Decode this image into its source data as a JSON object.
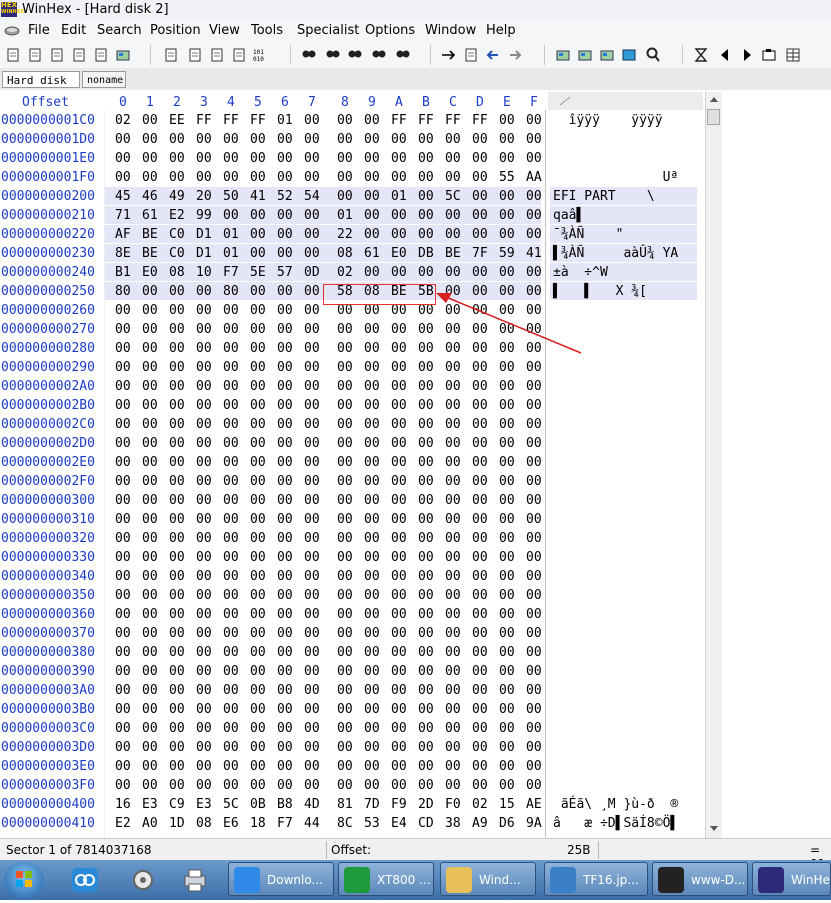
{
  "window": {
    "title": "WinHex - [Hard disk 2]"
  },
  "app_icon_lines": [
    "HEX",
    "WINHEX"
  ],
  "menu": [
    "File",
    "Edit",
    "Search",
    "Position",
    "View",
    "Tools",
    "Specialist",
    "Options",
    "Window",
    "Help"
  ],
  "toolbar_icons": [
    "new-file-icon",
    "open-folder-icon",
    "save-icon",
    "print-icon",
    "properties-icon",
    "open-disk-icon",
    "undo-icon",
    "copy-icon",
    "paste-icon",
    "paste-special-icon",
    "hex-convert-icon",
    "find-text-icon",
    "find-hex-icon",
    "replace-text-icon",
    "replace-hex-icon",
    "find-next-icon",
    "goto-offset-icon",
    "goto-sector-icon",
    "back-icon",
    "forward-icon",
    "disk-editor-icon",
    "ram-editor-icon",
    "clone-disk-icon",
    "calculator-icon",
    "search-icon",
    "hourglass-icon",
    "prev-sector-icon",
    "next-sector-icon",
    "snapshot-icon",
    "table-icon"
  ],
  "tabs": [
    {
      "label": "Hard disk 2",
      "active": true
    },
    {
      "label": "noname",
      "active": false
    }
  ],
  "hex_header": {
    "offset": "Offset",
    "columns": [
      "0",
      "1",
      "2",
      "3",
      "4",
      "5",
      "6",
      "7",
      "8",
      "9",
      "A",
      "B",
      "C",
      "D",
      "E",
      "F"
    ]
  },
  "rows": [
    {
      "offset": "0000000001C0",
      "bytes": [
        "02",
        "00",
        "EE",
        "FF",
        "FF",
        "FF",
        "01",
        "00",
        "00",
        "00",
        "FF",
        "FF",
        "FF",
        "FF",
        "00",
        "00"
      ],
      "text": "  îÿÿÿ    ÿÿÿÿ",
      "band": false
    },
    {
      "offset": "0000000001D0",
      "bytes": [
        "00",
        "00",
        "00",
        "00",
        "00",
        "00",
        "00",
        "00",
        "00",
        "00",
        "00",
        "00",
        "00",
        "00",
        "00",
        "00"
      ],
      "text": "",
      "band": false
    },
    {
      "offset": "0000000001E0",
      "bytes": [
        "00",
        "00",
        "00",
        "00",
        "00",
        "00",
        "00",
        "00",
        "00",
        "00",
        "00",
        "00",
        "00",
        "00",
        "00",
        "00"
      ],
      "text": "",
      "band": false
    },
    {
      "offset": "0000000001F0",
      "bytes": [
        "00",
        "00",
        "00",
        "00",
        "00",
        "00",
        "00",
        "00",
        "00",
        "00",
        "00",
        "00",
        "00",
        "00",
        "55",
        "AA"
      ],
      "text": "              Uª",
      "band": false
    },
    {
      "offset": "000000000200",
      "bytes": [
        "45",
        "46",
        "49",
        "20",
        "50",
        "41",
        "52",
        "54",
        "00",
        "00",
        "01",
        "00",
        "5C",
        "00",
        "00",
        "00"
      ],
      "text": "EFI PART    \\",
      "band": true
    },
    {
      "offset": "000000000210",
      "bytes": [
        "71",
        "61",
        "E2",
        "99",
        "00",
        "00",
        "00",
        "00",
        "01",
        "00",
        "00",
        "00",
        "00",
        "00",
        "00",
        "00"
      ],
      "text": "qaâ▌",
      "band": true
    },
    {
      "offset": "000000000220",
      "bytes": [
        "AF",
        "BE",
        "C0",
        "D1",
        "01",
        "00",
        "00",
        "00",
        "22",
        "00",
        "00",
        "00",
        "00",
        "00",
        "00",
        "00"
      ],
      "text": "¯¾ÀÑ    \"",
      "band": true
    },
    {
      "offset": "000000000230",
      "bytes": [
        "8E",
        "BE",
        "C0",
        "D1",
        "01",
        "00",
        "00",
        "00",
        "08",
        "61",
        "E0",
        "DB",
        "BE",
        "7F",
        "59",
        "41"
      ],
      "text": "▌¾ÀÑ     aàÛ¾ YA",
      "band": true
    },
    {
      "offset": "000000000240",
      "bytes": [
        "B1",
        "E0",
        "08",
        "10",
        "F7",
        "5E",
        "57",
        "0D",
        "02",
        "00",
        "00",
        "00",
        "00",
        "00",
        "00",
        "00"
      ],
      "text": "±à  ÷^W",
      "band": true
    },
    {
      "offset": "000000000250",
      "bytes": [
        "80",
        "00",
        "00",
        "00",
        "80",
        "00",
        "00",
        "00",
        "58",
        "08",
        "BE",
        "5B",
        "00",
        "00",
        "00",
        "00"
      ],
      "text": "▌   ▌   X ¾[",
      "band": true
    },
    {
      "offset": "000000000260",
      "bytes": [
        "00",
        "00",
        "00",
        "00",
        "00",
        "00",
        "00",
        "00",
        "00",
        "00",
        "00",
        "00",
        "00",
        "00",
        "00",
        "00"
      ],
      "text": "",
      "band": false
    },
    {
      "offset": "000000000270",
      "bytes": [
        "00",
        "00",
        "00",
        "00",
        "00",
        "00",
        "00",
        "00",
        "00",
        "00",
        "00",
        "00",
        "00",
        "00",
        "00",
        "00"
      ],
      "text": "",
      "band": false
    },
    {
      "offset": "000000000280",
      "bytes": [
        "00",
        "00",
        "00",
        "00",
        "00",
        "00",
        "00",
        "00",
        "00",
        "00",
        "00",
        "00",
        "00",
        "00",
        "00",
        "00"
      ],
      "text": "",
      "band": false
    },
    {
      "offset": "000000000290",
      "bytes": [
        "00",
        "00",
        "00",
        "00",
        "00",
        "00",
        "00",
        "00",
        "00",
        "00",
        "00",
        "00",
        "00",
        "00",
        "00",
        "00"
      ],
      "text": "",
      "band": false
    },
    {
      "offset": "0000000002A0",
      "bytes": [
        "00",
        "00",
        "00",
        "00",
        "00",
        "00",
        "00",
        "00",
        "00",
        "00",
        "00",
        "00",
        "00",
        "00",
        "00",
        "00"
      ],
      "text": "",
      "band": false
    },
    {
      "offset": "0000000002B0",
      "bytes": [
        "00",
        "00",
        "00",
        "00",
        "00",
        "00",
        "00",
        "00",
        "00",
        "00",
        "00",
        "00",
        "00",
        "00",
        "00",
        "00"
      ],
      "text": "",
      "band": false
    },
    {
      "offset": "0000000002C0",
      "bytes": [
        "00",
        "00",
        "00",
        "00",
        "00",
        "00",
        "00",
        "00",
        "00",
        "00",
        "00",
        "00",
        "00",
        "00",
        "00",
        "00"
      ],
      "text": "",
      "band": false
    },
    {
      "offset": "0000000002D0",
      "bytes": [
        "00",
        "00",
        "00",
        "00",
        "00",
        "00",
        "00",
        "00",
        "00",
        "00",
        "00",
        "00",
        "00",
        "00",
        "00",
        "00"
      ],
      "text": "",
      "band": false
    },
    {
      "offset": "0000000002E0",
      "bytes": [
        "00",
        "00",
        "00",
        "00",
        "00",
        "00",
        "00",
        "00",
        "00",
        "00",
        "00",
        "00",
        "00",
        "00",
        "00",
        "00"
      ],
      "text": "",
      "band": false
    },
    {
      "offset": "0000000002F0",
      "bytes": [
        "00",
        "00",
        "00",
        "00",
        "00",
        "00",
        "00",
        "00",
        "00",
        "00",
        "00",
        "00",
        "00",
        "00",
        "00",
        "00"
      ],
      "text": "",
      "band": false
    },
    {
      "offset": "000000000300",
      "bytes": [
        "00",
        "00",
        "00",
        "00",
        "00",
        "00",
        "00",
        "00",
        "00",
        "00",
        "00",
        "00",
        "00",
        "00",
        "00",
        "00"
      ],
      "text": "",
      "band": false
    },
    {
      "offset": "000000000310",
      "bytes": [
        "00",
        "00",
        "00",
        "00",
        "00",
        "00",
        "00",
        "00",
        "00",
        "00",
        "00",
        "00",
        "00",
        "00",
        "00",
        "00"
      ],
      "text": "",
      "band": false
    },
    {
      "offset": "000000000320",
      "bytes": [
        "00",
        "00",
        "00",
        "00",
        "00",
        "00",
        "00",
        "00",
        "00",
        "00",
        "00",
        "00",
        "00",
        "00",
        "00",
        "00"
      ],
      "text": "",
      "band": false
    },
    {
      "offset": "000000000330",
      "bytes": [
        "00",
        "00",
        "00",
        "00",
        "00",
        "00",
        "00",
        "00",
        "00",
        "00",
        "00",
        "00",
        "00",
        "00",
        "00",
        "00"
      ],
      "text": "",
      "band": false
    },
    {
      "offset": "000000000340",
      "bytes": [
        "00",
        "00",
        "00",
        "00",
        "00",
        "00",
        "00",
        "00",
        "00",
        "00",
        "00",
        "00",
        "00",
        "00",
        "00",
        "00"
      ],
      "text": "",
      "band": false
    },
    {
      "offset": "000000000350",
      "bytes": [
        "00",
        "00",
        "00",
        "00",
        "00",
        "00",
        "00",
        "00",
        "00",
        "00",
        "00",
        "00",
        "00",
        "00",
        "00",
        "00"
      ],
      "text": "",
      "band": false
    },
    {
      "offset": "000000000360",
      "bytes": [
        "00",
        "00",
        "00",
        "00",
        "00",
        "00",
        "00",
        "00",
        "00",
        "00",
        "00",
        "00",
        "00",
        "00",
        "00",
        "00"
      ],
      "text": "",
      "band": false
    },
    {
      "offset": "000000000370",
      "bytes": [
        "00",
        "00",
        "00",
        "00",
        "00",
        "00",
        "00",
        "00",
        "00",
        "00",
        "00",
        "00",
        "00",
        "00",
        "00",
        "00"
      ],
      "text": "",
      "band": false
    },
    {
      "offset": "000000000380",
      "bytes": [
        "00",
        "00",
        "00",
        "00",
        "00",
        "00",
        "00",
        "00",
        "00",
        "00",
        "00",
        "00",
        "00",
        "00",
        "00",
        "00"
      ],
      "text": "",
      "band": false
    },
    {
      "offset": "000000000390",
      "bytes": [
        "00",
        "00",
        "00",
        "00",
        "00",
        "00",
        "00",
        "00",
        "00",
        "00",
        "00",
        "00",
        "00",
        "00",
        "00",
        "00"
      ],
      "text": "",
      "band": false
    },
    {
      "offset": "0000000003A0",
      "bytes": [
        "00",
        "00",
        "00",
        "00",
        "00",
        "00",
        "00",
        "00",
        "00",
        "00",
        "00",
        "00",
        "00",
        "00",
        "00",
        "00"
      ],
      "text": "",
      "band": false
    },
    {
      "offset": "0000000003B0",
      "bytes": [
        "00",
        "00",
        "00",
        "00",
        "00",
        "00",
        "00",
        "00",
        "00",
        "00",
        "00",
        "00",
        "00",
        "00",
        "00",
        "00"
      ],
      "text": "",
      "band": false
    },
    {
      "offset": "0000000003C0",
      "bytes": [
        "00",
        "00",
        "00",
        "00",
        "00",
        "00",
        "00",
        "00",
        "00",
        "00",
        "00",
        "00",
        "00",
        "00",
        "00",
        "00"
      ],
      "text": "",
      "band": false
    },
    {
      "offset": "0000000003D0",
      "bytes": [
        "00",
        "00",
        "00",
        "00",
        "00",
        "00",
        "00",
        "00",
        "00",
        "00",
        "00",
        "00",
        "00",
        "00",
        "00",
        "00"
      ],
      "text": "",
      "band": false
    },
    {
      "offset": "0000000003E0",
      "bytes": [
        "00",
        "00",
        "00",
        "00",
        "00",
        "00",
        "00",
        "00",
        "00",
        "00",
        "00",
        "00",
        "00",
        "00",
        "00",
        "00"
      ],
      "text": "",
      "band": false
    },
    {
      "offset": "0000000003F0",
      "bytes": [
        "00",
        "00",
        "00",
        "00",
        "00",
        "00",
        "00",
        "00",
        "00",
        "00",
        "00",
        "00",
        "00",
        "00",
        "00",
        "00"
      ],
      "text": "",
      "band": false
    },
    {
      "offset": "000000000400",
      "bytes": [
        "16",
        "E3",
        "C9",
        "E3",
        "5C",
        "0B",
        "B8",
        "4D",
        "81",
        "7D",
        "F9",
        "2D",
        "F0",
        "02",
        "15",
        "AE"
      ],
      "text": " ãÉã\\ ¸M }ù-ð  ®",
      "band": false
    },
    {
      "offset": "000000000410",
      "bytes": [
        "E2",
        "A0",
        "1D",
        "08",
        "E6",
        "18",
        "F7",
        "44",
        "8C",
        "53",
        "E4",
        "CD",
        "38",
        "A9",
        "D6",
        "9A"
      ],
      "text": "â   æ ÷D▌SäÍ8©Ö▌",
      "band": false
    }
  ],
  "status": {
    "sector": "Sector 1 of 7814037168",
    "offset_label": "Offset:",
    "offset_value": "25B",
    "extra": "= 91"
  },
  "taskbar": {
    "tasks": [
      {
        "label": "Downlo...",
        "icon": "browser-icon"
      },
      {
        "label": "XT800 ...",
        "icon": "remote-icon"
      },
      {
        "label": "Wind...",
        "icon": "folder-icon"
      },
      {
        "label": "TF16.jp...",
        "icon": "image-viewer-icon"
      },
      {
        "label": "www-D...",
        "icon": "penguin-icon"
      },
      {
        "label": "WinHe",
        "icon": "winhex-icon"
      }
    ],
    "quick_launch": [
      "network-icon",
      "disc-icon",
      "printer-icon"
    ]
  },
  "colors": {
    "offset_blue": "#1c3cc8",
    "band": "#e4e6f8",
    "highlight": "#e03030"
  }
}
